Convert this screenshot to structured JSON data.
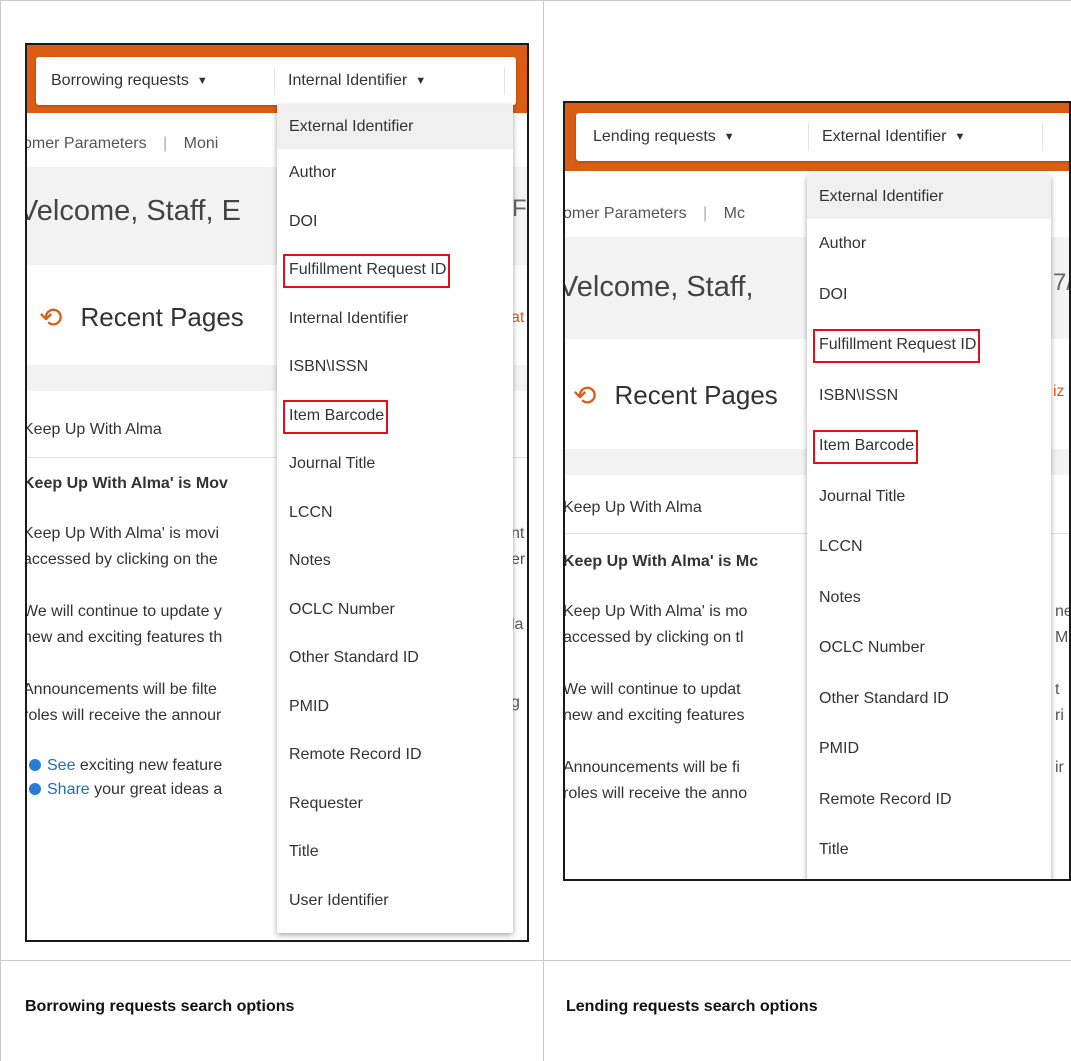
{
  "captions": {
    "borrowing": "Borrowing requests search options",
    "lending": "Lending requests search options"
  },
  "brand_color": "#d95d12",
  "highlight_color": "#e0101b",
  "borrowing": {
    "search_type": "Borrowing requests",
    "search_field": "Internal Identifier",
    "subnav": "omer Parameters",
    "subnav_sep": "|",
    "subnav_more": "Moni",
    "welcome": "Velcome, Staff, E",
    "welcome_tail": "F",
    "recent_pages": "Recent Pages",
    "recent_tail": "at",
    "keep_up_title": "Keep Up With Alma",
    "keep_up_bold": "Keep Up With Alma' is Mov",
    "p1_line1": "Keep Up With Alma' is movi",
    "p1_line2": "accessed by clicking on the",
    "p2_line1": "We will continue to update y",
    "p2_line2": "new and exciting features th",
    "p3_line1": "Announcements will be filte",
    "p3_line2": "roles will receive the annour",
    "see_link": "See",
    "see_text": " exciting new feature",
    "share_link": "Share",
    "share_text": " your great ideas a",
    "edge": [
      "nt",
      "er",
      "la",
      "g"
    ],
    "menu": [
      {
        "label": "External Identifier",
        "selected": true,
        "highlight": false
      },
      {
        "label": "Author",
        "selected": false,
        "highlight": false
      },
      {
        "label": "DOI",
        "selected": false,
        "highlight": false
      },
      {
        "label": "Fulfillment Request ID",
        "selected": false,
        "highlight": true
      },
      {
        "label": "Internal Identifier",
        "selected": false,
        "highlight": false
      },
      {
        "label": "ISBN\\ISSN",
        "selected": false,
        "highlight": false
      },
      {
        "label": "Item Barcode",
        "selected": false,
        "highlight": true
      },
      {
        "label": "Journal Title",
        "selected": false,
        "highlight": false
      },
      {
        "label": "LCCN",
        "selected": false,
        "highlight": false
      },
      {
        "label": "Notes",
        "selected": false,
        "highlight": false
      },
      {
        "label": "OCLC Number",
        "selected": false,
        "highlight": false
      },
      {
        "label": "Other Standard ID",
        "selected": false,
        "highlight": false
      },
      {
        "label": "PMID",
        "selected": false,
        "highlight": false
      },
      {
        "label": "Remote Record ID",
        "selected": false,
        "highlight": false
      },
      {
        "label": "Requester",
        "selected": false,
        "highlight": false
      },
      {
        "label": "Title",
        "selected": false,
        "highlight": false
      },
      {
        "label": "User Identifier",
        "selected": false,
        "highlight": false
      }
    ]
  },
  "lending": {
    "search_type": "Lending requests",
    "search_field": "External Identifier",
    "subnav": "omer Parameters",
    "subnav_sep": "|",
    "subnav_more": "Mc",
    "welcome": "Velcome, Staff,",
    "welcome_tail": "7/",
    "recent_pages": "Recent Pages",
    "recent_tail": "iz",
    "keep_up_title": "Keep Up With Alma",
    "keep_up_bold": "Keep Up With Alma' is Mc",
    "p1_line1": "Keep Up With Alma' is mo",
    "p1_line2": "accessed by clicking on tl",
    "p2_line1": "We will continue to updat",
    "p2_line2": "new and exciting features",
    "p3_line1": "Announcements will be fi",
    "p3_line2": "roles will receive the anno",
    "edge": [
      "ne",
      "M",
      "t",
      "ri",
      "ir"
    ],
    "menu": [
      {
        "label": "External Identifier",
        "selected": true,
        "highlight": false
      },
      {
        "label": "Author",
        "selected": false,
        "highlight": false
      },
      {
        "label": "DOI",
        "selected": false,
        "highlight": false
      },
      {
        "label": "Fulfillment Request ID",
        "selected": false,
        "highlight": true
      },
      {
        "label": "ISBN\\ISSN",
        "selected": false,
        "highlight": false
      },
      {
        "label": "Item Barcode",
        "selected": false,
        "highlight": true
      },
      {
        "label": "Journal Title",
        "selected": false,
        "highlight": false
      },
      {
        "label": "LCCN",
        "selected": false,
        "highlight": false
      },
      {
        "label": "Notes",
        "selected": false,
        "highlight": false
      },
      {
        "label": "OCLC Number",
        "selected": false,
        "highlight": false
      },
      {
        "label": "Other Standard ID",
        "selected": false,
        "highlight": false
      },
      {
        "label": "PMID",
        "selected": false,
        "highlight": false
      },
      {
        "label": "Remote Record ID",
        "selected": false,
        "highlight": false
      },
      {
        "label": "Title",
        "selected": false,
        "highlight": false
      }
    ]
  }
}
